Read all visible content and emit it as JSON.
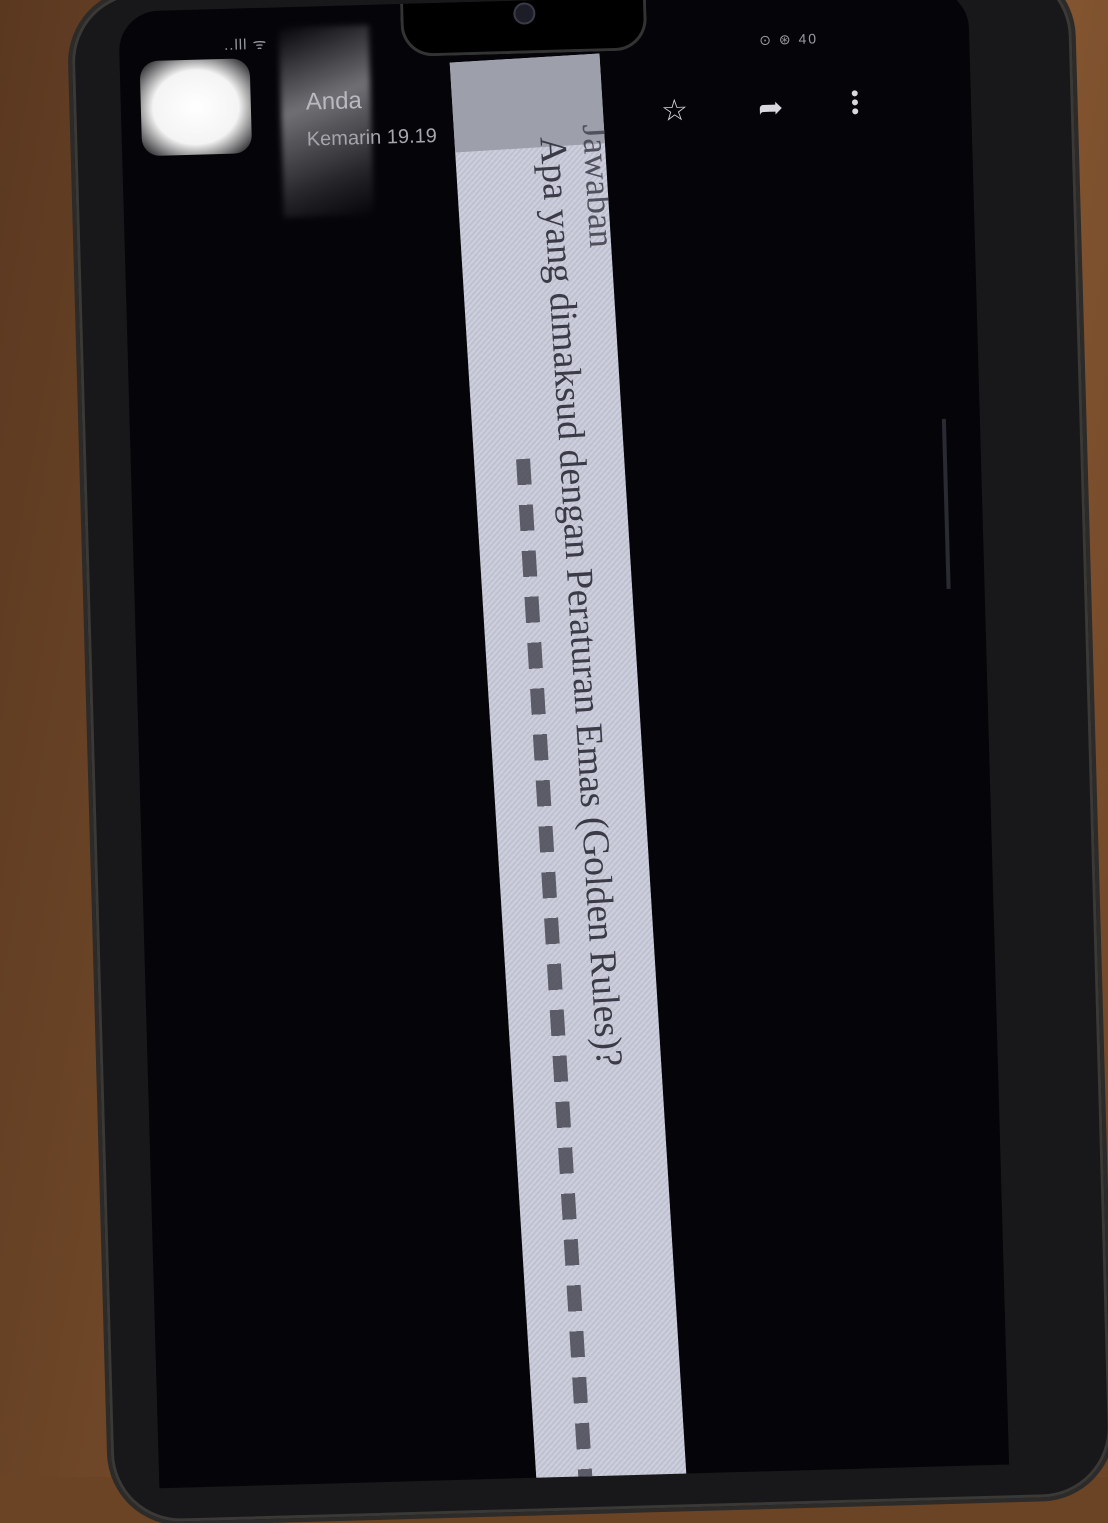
{
  "status_bar": {
    "left_text": "..lll ᯤ",
    "right_text": "⊙ ⊛ 40"
  },
  "message_header": {
    "sender": "Anda",
    "time": "Kemarin 19.19"
  },
  "actions": {
    "star_icon": "star-icon",
    "forward_icon": "forward-icon",
    "more_icon": "more-vertical-icon"
  },
  "attachment": {
    "question_text": "Apa yang dimaksud dengan Peraturan Emas (Golden Rules)?",
    "fragment_text": "Jawaban"
  }
}
